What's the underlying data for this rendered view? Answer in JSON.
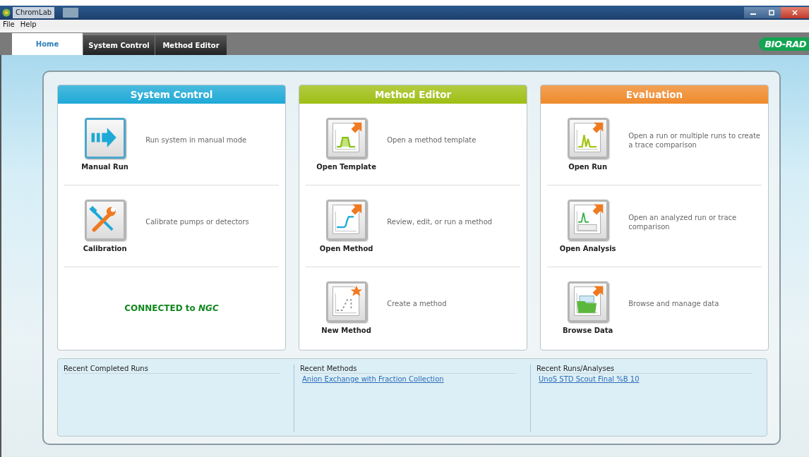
{
  "window": {
    "title": "ChromLab"
  },
  "menu": [
    "File",
    "Help"
  ],
  "tabs": [
    {
      "label": "Home",
      "selected": true
    },
    {
      "label": "System Control",
      "selected": false
    },
    {
      "label": "Method Editor",
      "selected": false
    }
  ],
  "logo": "BIO-RAD",
  "cards": [
    {
      "title": "System Control",
      "color": "#1ea9d6",
      "items": [
        {
          "kind": "manual-run",
          "label": "Manual Run",
          "description": "Run system in manual mode"
        },
        {
          "kind": "calibration",
          "label": "Calibration",
          "description": "Calibrate pumps or detectors"
        },
        {
          "kind": "status",
          "text": "CONNECTED to *NGC*"
        }
      ]
    },
    {
      "title": "Method Editor",
      "color": "#9fbe14",
      "items": [
        {
          "kind": "template",
          "label": "Open Template",
          "description": "Open a method template"
        },
        {
          "kind": "method",
          "label": "Open Method",
          "description": "Review, edit, or run a method"
        },
        {
          "kind": "new-method",
          "label": "New Method",
          "description": "Create a method"
        }
      ]
    },
    {
      "title": "Evaluation",
      "color": "#ef8a2c",
      "items": [
        {
          "kind": "run",
          "label": "Open Run",
          "description": "Open a run or multiple runs to create a trace comparison"
        },
        {
          "kind": "analysis",
          "label": "Open Analysis",
          "description": "Open an analyzed run or trace comparison"
        },
        {
          "kind": "browse",
          "label": "Browse Data",
          "description": "Browse and manage data"
        }
      ]
    }
  ],
  "recent": [
    {
      "title": "Recent Completed Runs"
    },
    {
      "title": "Recent Methods",
      "links": [
        "Anion Exchange with Fraction Collection"
      ]
    },
    {
      "title": "Recent Runs/Analyses",
      "links": [
        "UnoS STD Scout Final %B 10"
      ]
    }
  ]
}
